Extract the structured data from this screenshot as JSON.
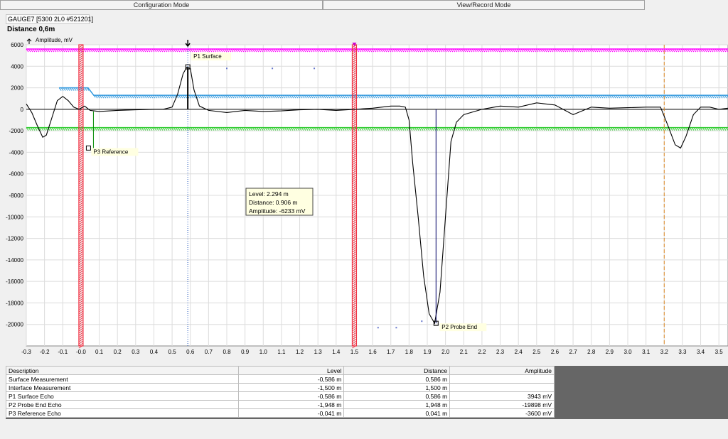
{
  "tabs": [
    {
      "label": "Configuration Mode"
    },
    {
      "label": "View/Record Mode"
    }
  ],
  "header": {
    "device": "GAUGE7 [5300 2L0 #521201]",
    "distance": "Distance 0,6m"
  },
  "colors": {
    "trace": "#000000",
    "upper_threshold": "#ff00ff",
    "surface_threshold": "#3399dd",
    "lower_threshold": "#33cc33",
    "red_marker": "#ee3344",
    "orange_marker": "#dd8822",
    "tooltip_bg": "#ffffe1"
  },
  "tooltip": {
    "lines": [
      "Level: 2.294 m",
      "Distance: 0.906 m",
      "Amplitude: -6233 mV"
    ]
  },
  "chart_data": {
    "type": "line",
    "ylabel": "Amplitude, mV",
    "xlim": [
      -0.3,
      3.55
    ],
    "ylim": [
      -22000,
      6000
    ],
    "y_ticks": [
      6000,
      4000,
      2000,
      0,
      -2000,
      -4000,
      -6000,
      -8000,
      -10000,
      -12000,
      -14000,
      -16000,
      -18000,
      -20000
    ],
    "x_ticks": [
      -0.3,
      -0.2,
      -0.1,
      -0.0,
      0.1,
      0.2,
      0.3,
      0.4,
      0.5,
      0.6,
      0.7,
      0.8,
      0.9,
      1.0,
      1.1,
      1.2,
      1.3,
      1.4,
      1.5,
      1.6,
      1.7,
      1.8,
      1.9,
      2.0,
      2.1,
      2.2,
      2.3,
      2.4,
      2.5,
      2.6,
      2.7,
      2.8,
      2.9,
      3.0,
      3.1,
      3.2,
      3.3,
      3.4,
      3.5
    ],
    "x_tick_labels": [
      "-0.3",
      "-0.2",
      "-0.1",
      "-0.0",
      "0.1",
      "0.2",
      "0.3",
      "0.4",
      "0.5",
      "0.6",
      "0.7",
      "0.8",
      "0.9",
      "1.0",
      "1.1",
      "1.2",
      "1.3",
      "1.4",
      "1.5",
      "1.6",
      "1.7",
      "1.8",
      "1.9",
      "2.0",
      "2.1",
      "2.2",
      "2.3",
      "2.4",
      "2.5",
      "2.6",
      "2.7",
      "2.8",
      "2.9",
      "3.0",
      "3.1",
      "3.2",
      "3.3",
      "3.4",
      "3.5"
    ],
    "grid": true,
    "series": [
      {
        "x": [
          -0.3,
          -0.27,
          -0.24,
          -0.21,
          -0.19,
          -0.16,
          -0.13,
          -0.1,
          -0.07,
          -0.04,
          -0.01,
          0.02,
          0.05,
          0.1,
          0.2,
          0.3,
          0.4,
          0.45,
          0.5,
          0.53,
          0.56,
          0.58,
          0.6,
          0.62,
          0.65,
          0.7,
          0.8,
          0.9,
          1.0,
          1.1,
          1.2,
          1.3,
          1.4,
          1.5,
          1.6,
          1.7,
          1.75,
          1.78,
          1.8,
          1.82,
          1.85,
          1.88,
          1.91,
          1.94,
          1.97,
          2.0,
          2.03,
          2.06,
          2.1,
          2.2,
          2.3,
          2.4,
          2.5,
          2.6,
          2.7,
          2.8,
          2.9,
          3.0,
          3.1,
          3.18,
          3.22,
          3.26,
          3.29,
          3.32,
          3.36,
          3.4,
          3.45,
          3.5,
          3.55
        ],
        "y": [
          500,
          -300,
          -1500,
          -2600,
          -2400,
          -800,
          800,
          1200,
          800,
          200,
          0,
          300,
          -100,
          -200,
          -100,
          -50,
          0,
          0,
          200,
          1400,
          3300,
          3900,
          3800,
          1800,
          300,
          -100,
          -300,
          -100,
          -200,
          -150,
          -50,
          0,
          -100,
          0,
          100,
          300,
          300,
          200,
          -1000,
          -5000,
          -10000,
          -15500,
          -19000,
          -19900,
          -17000,
          -10000,
          -3000,
          -1200,
          -500,
          0,
          300,
          200,
          600,
          400,
          -500,
          200,
          100,
          150,
          200,
          200,
          -1500,
          -3300,
          -3600,
          -2500,
          -500,
          200,
          200,
          0,
          100
        ]
      }
    ],
    "thresholds": [
      {
        "y": 5600,
        "color": "#ff00ff"
      },
      {
        "y": 1300,
        "color": "#3399dd",
        "step_x": [
          -0.12,
          0.07
        ],
        "step_y": 2000
      },
      {
        "y": -1700,
        "color": "#33cc33"
      }
    ],
    "vlines": [
      {
        "x": -0.0,
        "style": "red-band"
      },
      {
        "x": 0.586,
        "style": "blue-dotted"
      },
      {
        "x": 1.5,
        "style": "red-band"
      },
      {
        "x": 3.2,
        "style": "orange-dashed"
      }
    ],
    "peaks": [
      {
        "label": "P1 Surface",
        "x": 0.586,
        "y": 3943
      },
      {
        "label": "P2 Probe End",
        "x": 1.948,
        "y": -19898
      },
      {
        "label": "P3 Reference",
        "x": 0.041,
        "y": -3600
      }
    ],
    "scatter_points": [
      {
        "x": 0.8,
        "y": 3800
      },
      {
        "x": 1.05,
        "y": 3800
      },
      {
        "x": 1.28,
        "y": 3800
      },
      {
        "x": 1.63,
        "y": -20300
      },
      {
        "x": 1.73,
        "y": -20300
      },
      {
        "x": 1.87,
        "y": -19700
      }
    ]
  },
  "table": {
    "headers": [
      "Description",
      "Level",
      "Distance",
      "Amplitude"
    ],
    "rows": [
      [
        "Surface Measurement",
        "-0,586 m",
        "0,586 m",
        ""
      ],
      [
        "Interface Measurement",
        "-1,500 m",
        "1,500 m",
        ""
      ],
      [
        "P1 Surface Echo",
        "-0,586 m",
        "0,586 m",
        "3943 mV"
      ],
      [
        "P2 Probe End Echo",
        "-1,948 m",
        "1,948 m",
        "-19898 mV"
      ],
      [
        "P3 Reference Echo",
        "-0,041 m",
        "0,041 m",
        "-3600 mV"
      ]
    ]
  }
}
